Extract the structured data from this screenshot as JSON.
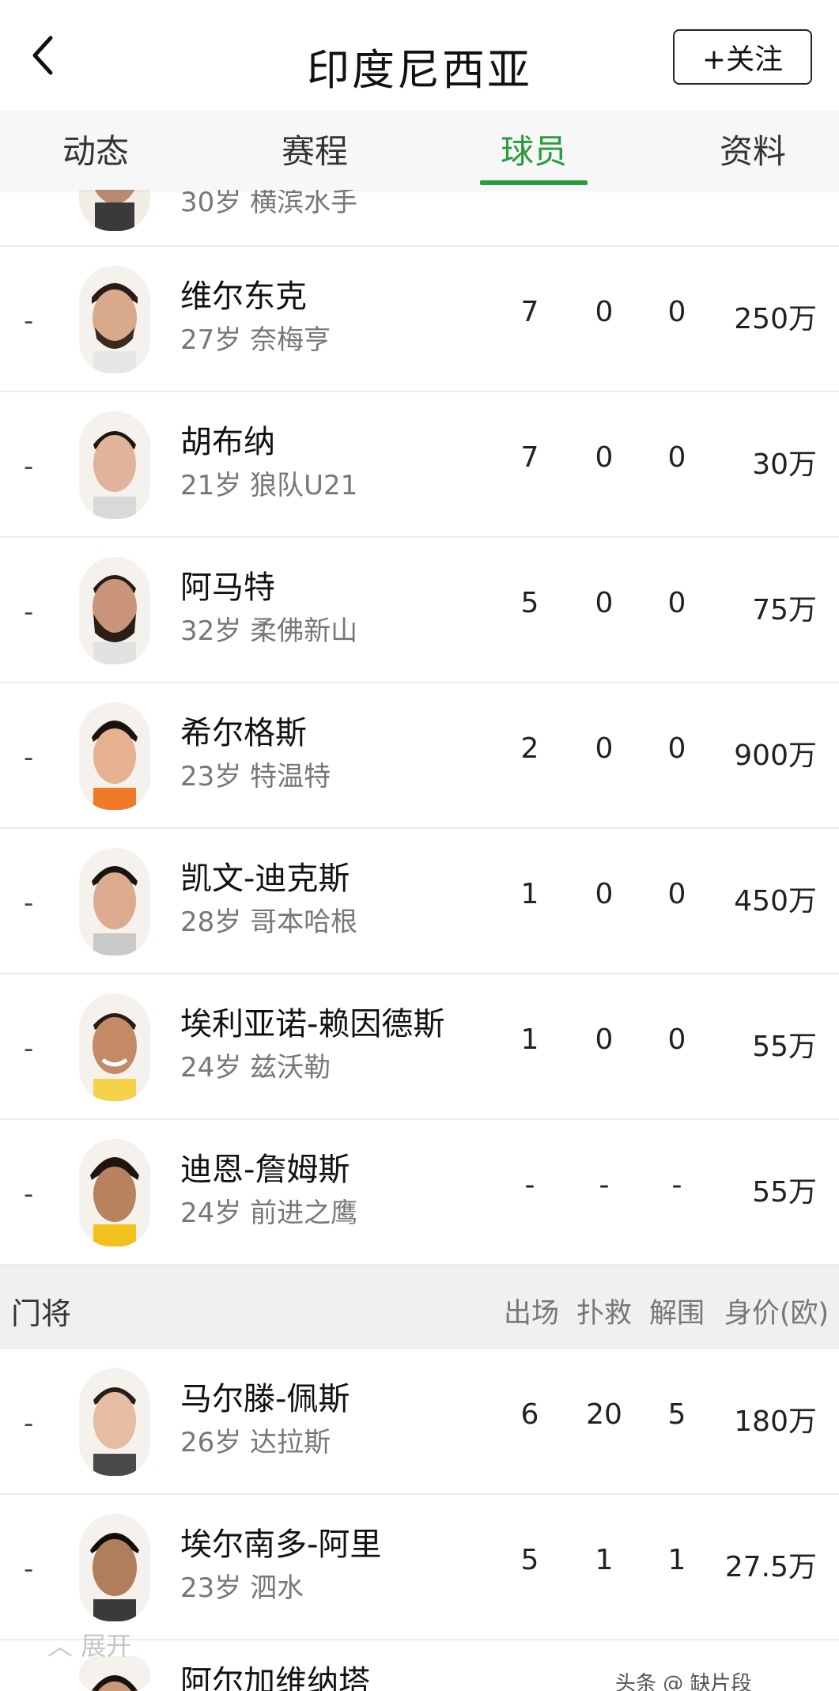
{
  "header": {
    "title": "印度尼西亚",
    "follow_label": "+关注"
  },
  "tabs": [
    {
      "label": "动态",
      "active": false
    },
    {
      "label": "赛程",
      "active": false
    },
    {
      "label": "球员",
      "active": true
    },
    {
      "label": "资料",
      "active": false
    }
  ],
  "partial_top_row": {
    "info": "30岁 横滨水手"
  },
  "players": [
    {
      "rank": "-",
      "name": "维尔东克",
      "info": "27岁 奈梅亨",
      "c1": "7",
      "c2": "0",
      "c3": "0",
      "value": "250万"
    },
    {
      "rank": "-",
      "name": "胡布纳",
      "info": "21岁 狼队U21",
      "c1": "7",
      "c2": "0",
      "c3": "0",
      "value": "30万"
    },
    {
      "rank": "-",
      "name": "阿马特",
      "info": "32岁 柔佛新山",
      "c1": "5",
      "c2": "0",
      "c3": "0",
      "value": "75万"
    },
    {
      "rank": "-",
      "name": "希尔格斯",
      "info": "23岁 特温特",
      "c1": "2",
      "c2": "0",
      "c3": "0",
      "value": "900万"
    },
    {
      "rank": "-",
      "name": "凯文-迪克斯",
      "info": "28岁 哥本哈根",
      "c1": "1",
      "c2": "0",
      "c3": "0",
      "value": "450万"
    },
    {
      "rank": "-",
      "name": "埃利亚诺-赖因德斯",
      "info": "24岁 兹沃勒",
      "c1": "1",
      "c2": "0",
      "c3": "0",
      "value": "55万"
    },
    {
      "rank": "-",
      "name": "迪恩-詹姆斯",
      "info": "24岁 前进之鹰",
      "c1": "-",
      "c2": "-",
      "c3": "-",
      "value": "55万"
    }
  ],
  "goalkeeper_section": {
    "title": "门将",
    "columns": [
      "出场",
      "扑救",
      "解围",
      "身价(欧)"
    ]
  },
  "goalkeepers": [
    {
      "rank": "-",
      "name": "马尔滕-佩斯",
      "info": "26岁 达拉斯",
      "c1": "6",
      "c2": "20",
      "c3": "5",
      "value": "180万"
    },
    {
      "rank": "-",
      "name": "埃尔南多-阿里",
      "info": "23岁 泗水",
      "c1": "5",
      "c2": "1",
      "c3": "1",
      "value": "27.5万"
    }
  ],
  "partial_bottom_row": {
    "name": "阿尔加维纳塔"
  },
  "overlay": {
    "expand_label": "展开",
    "watermark": "头条 @ 缺片段"
  },
  "colors": {
    "accent": "#2a9b3a",
    "section_bg": "#f0f0f0",
    "tabs_bg": "#f7f7f7"
  },
  "icons": {
    "back": "chevron-left-icon",
    "expand": "chevron-up-icon"
  }
}
